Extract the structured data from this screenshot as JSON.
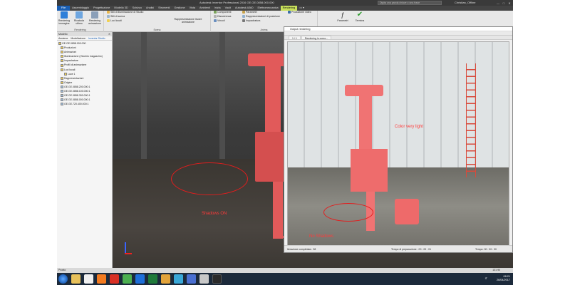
{
  "window": {
    "title": "Autodesk Inventor Professional 2016  GE.GE.0858.000.000",
    "search_placeholder": "Digita una parola chiave o una frase",
    "user": "Christian_Offline",
    "controls": [
      "—",
      "□",
      "✕"
    ]
  },
  "ribbon_tabs": [
    {
      "label": "File",
      "kind": "file"
    },
    {
      "label": "Assemblaggio"
    },
    {
      "label": "Progettazione"
    },
    {
      "label": "Modello 3D"
    },
    {
      "label": "Schizzo"
    },
    {
      "label": "Analisi"
    },
    {
      "label": "Strumenti"
    },
    {
      "label": "Gestione"
    },
    {
      "label": "Vista"
    },
    {
      "label": "Ambienti"
    },
    {
      "label": "Inizia"
    },
    {
      "label": "Vault"
    },
    {
      "label": "Autodesk A360"
    },
    {
      "label": "Elettromeccanica"
    },
    {
      "label": "Rendering",
      "kind": "active"
    },
    {
      "label": "▭ ▾"
    }
  ],
  "ribbon": {
    "render_group": {
      "label": "Rendering",
      "buttons": [
        "Rendering immagine",
        "Ricalcola ultimo",
        "Rendering animazione"
      ]
    },
    "scene_group": {
      "label": "Scena",
      "items": [
        "Stili di illuminazione di Studio",
        "Stili di scena",
        "Luci locali"
      ],
      "big_button": "Rappresentazione levare animazione"
    },
    "animate_group": {
      "label": "Anima",
      "col1": [
        "Componenti",
        "Dissolvenza",
        "Vincoli"
      ],
      "col2": [
        "Parametri",
        "Rappresentazioni di posizione",
        "Inquadratura"
      ],
      "col3": [
        "Produzione video"
      ]
    },
    "params_button": "Parametri",
    "finish_button": "Termina"
  },
  "browser": {
    "title": "Modello",
    "tabs": [
      "Assieme",
      "Modellazione",
      "Inventor Studio"
    ],
    "nodes": [
      "GE.GE.0858.000.000",
      "Produzioni",
      "Animazioni",
      "Illuminazione (Vecchio magazzino)",
      "Inquadrature",
      "Profili di animazione",
      "Luci locali",
      "Luce 1",
      "Rappresentazioni",
      "Origine",
      "GE.GE.0858.200.000:1",
      "GE.GE.0858.100.000:1",
      "GE.GE.0858.300.000:1",
      "GE.GE.0858.000.000:1",
      "GE.GE.720.400.000:1"
    ]
  },
  "annotations": {
    "left": "Shadows ON",
    "right_top": "Color very light",
    "right_bottom": "No Shadows"
  },
  "output_window": {
    "title": "Output rendering",
    "tabs": [
      "1 / 1",
      "Rendering in corso..."
    ],
    "status_left": "Iterazione completata : 38",
    "status_mid": "Tempo di preparazione : 00 : 00 : 01",
    "status_right": "Tempo: 00 : 00 : 30"
  },
  "status": {
    "left": "Pronto",
    "right": "131    90"
  },
  "taskbar": {
    "lang": "IT",
    "time": "08:21",
    "date": "26/04/2017"
  },
  "colors": {
    "part_red": "#e15a5a",
    "annotation_red": "#ff3a3a",
    "active_tab": "#c8e05b",
    "file_tab": "#1a5fb4"
  }
}
